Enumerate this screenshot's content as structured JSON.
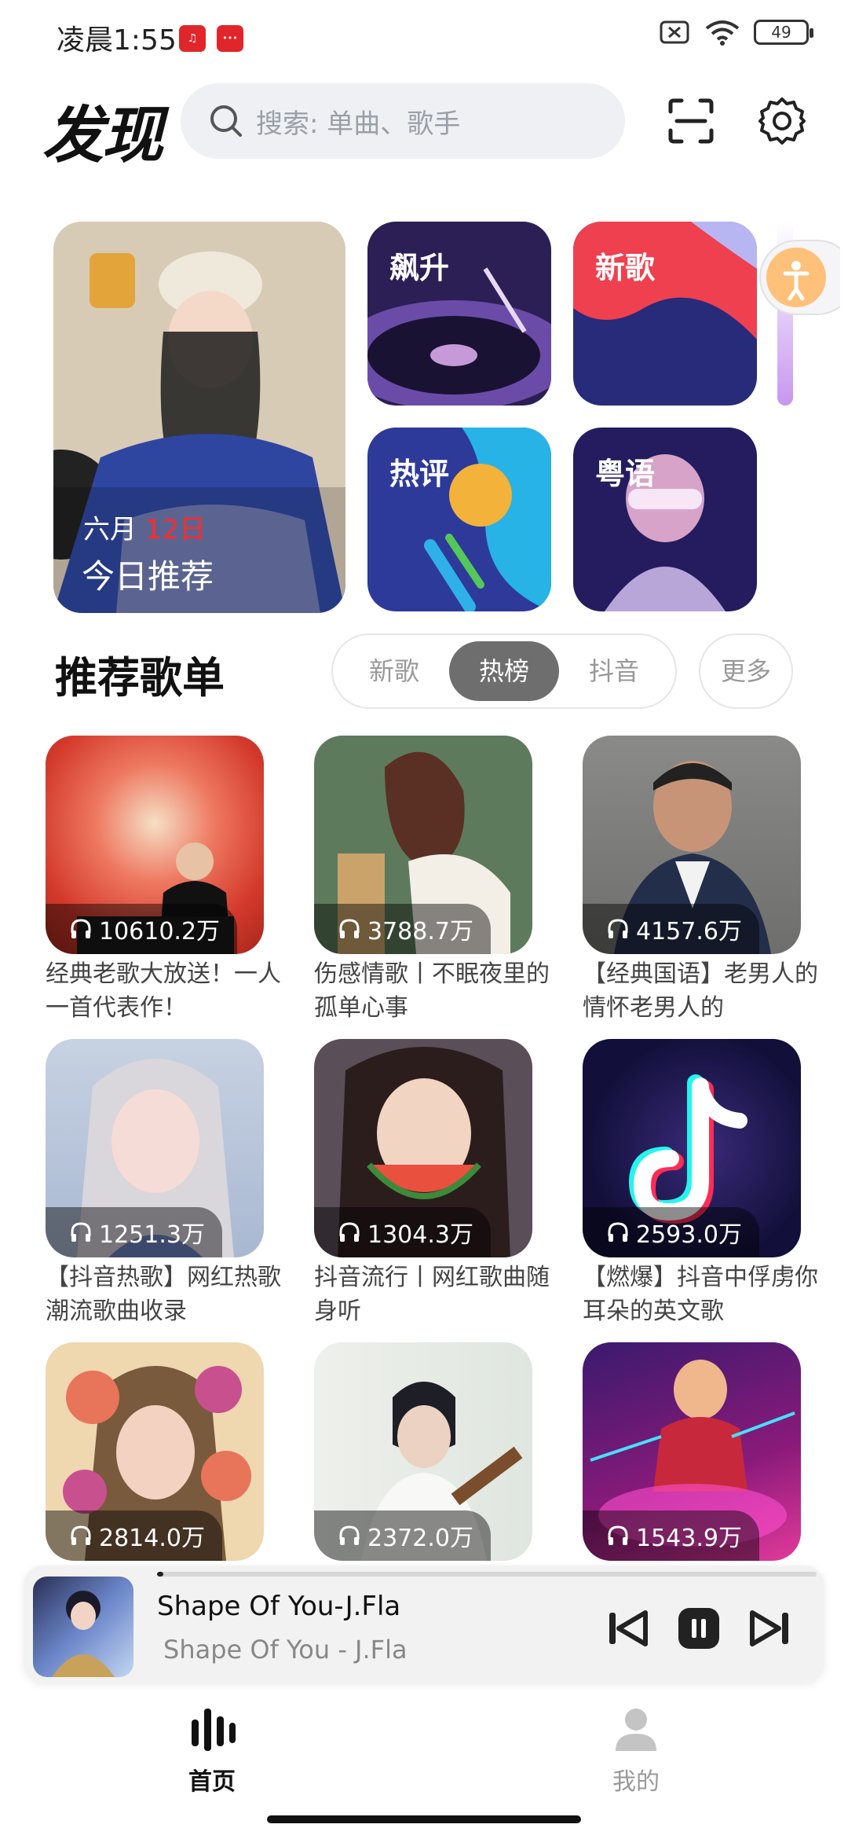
{
  "status_bar": {
    "time": "凌晨1:55",
    "battery": "49"
  },
  "header": {
    "title": "发现",
    "search_placeholder": "搜索: 单曲、歌手"
  },
  "top_cards": {
    "today": {
      "month": "六月 ",
      "day": "12日",
      "label": "今日推荐"
    },
    "rising": "飙升",
    "new_songs": "新歌",
    "hot_comments": "热评",
    "cantonese": "粤语"
  },
  "playlist_section": {
    "title": "推荐歌单",
    "tabs": [
      "新歌",
      "热榜",
      "抖音"
    ],
    "active_tab": "热榜",
    "more": "更多"
  },
  "playlists": [
    {
      "count": "10610.2万",
      "title": "经典老歌大放送！一人一首代表作！"
    },
    {
      "count": "3788.7万",
      "title": "伤感情歌丨不眠夜里的孤单心事"
    },
    {
      "count": "4157.6万",
      "title": "【经典国语】老男人的情怀老男人的"
    },
    {
      "count": "1251.3万",
      "title": "【抖音热歌】网红热歌潮流歌曲收录"
    },
    {
      "count": "1304.3万",
      "title": "抖音流行丨网红歌曲随身听"
    },
    {
      "count": "2593.0万",
      "title": "【燃爆】抖音中俘虏你耳朵的英文歌"
    },
    {
      "count": "2814.0万",
      "title": ""
    },
    {
      "count": "2372.0万",
      "title": ""
    },
    {
      "count": "1543.9万",
      "title": ""
    }
  ],
  "player": {
    "title": "Shape Of You-J.Fla",
    "subtitle": "Shape Of You - J.Fla",
    "progress": 0.01
  },
  "nav": {
    "home": "首页",
    "mine": "我的"
  },
  "colors": {
    "accent_red": "#ff2a2a",
    "tab_active_bg": "#6e6e6e",
    "search_bg": "#eef0f4"
  }
}
